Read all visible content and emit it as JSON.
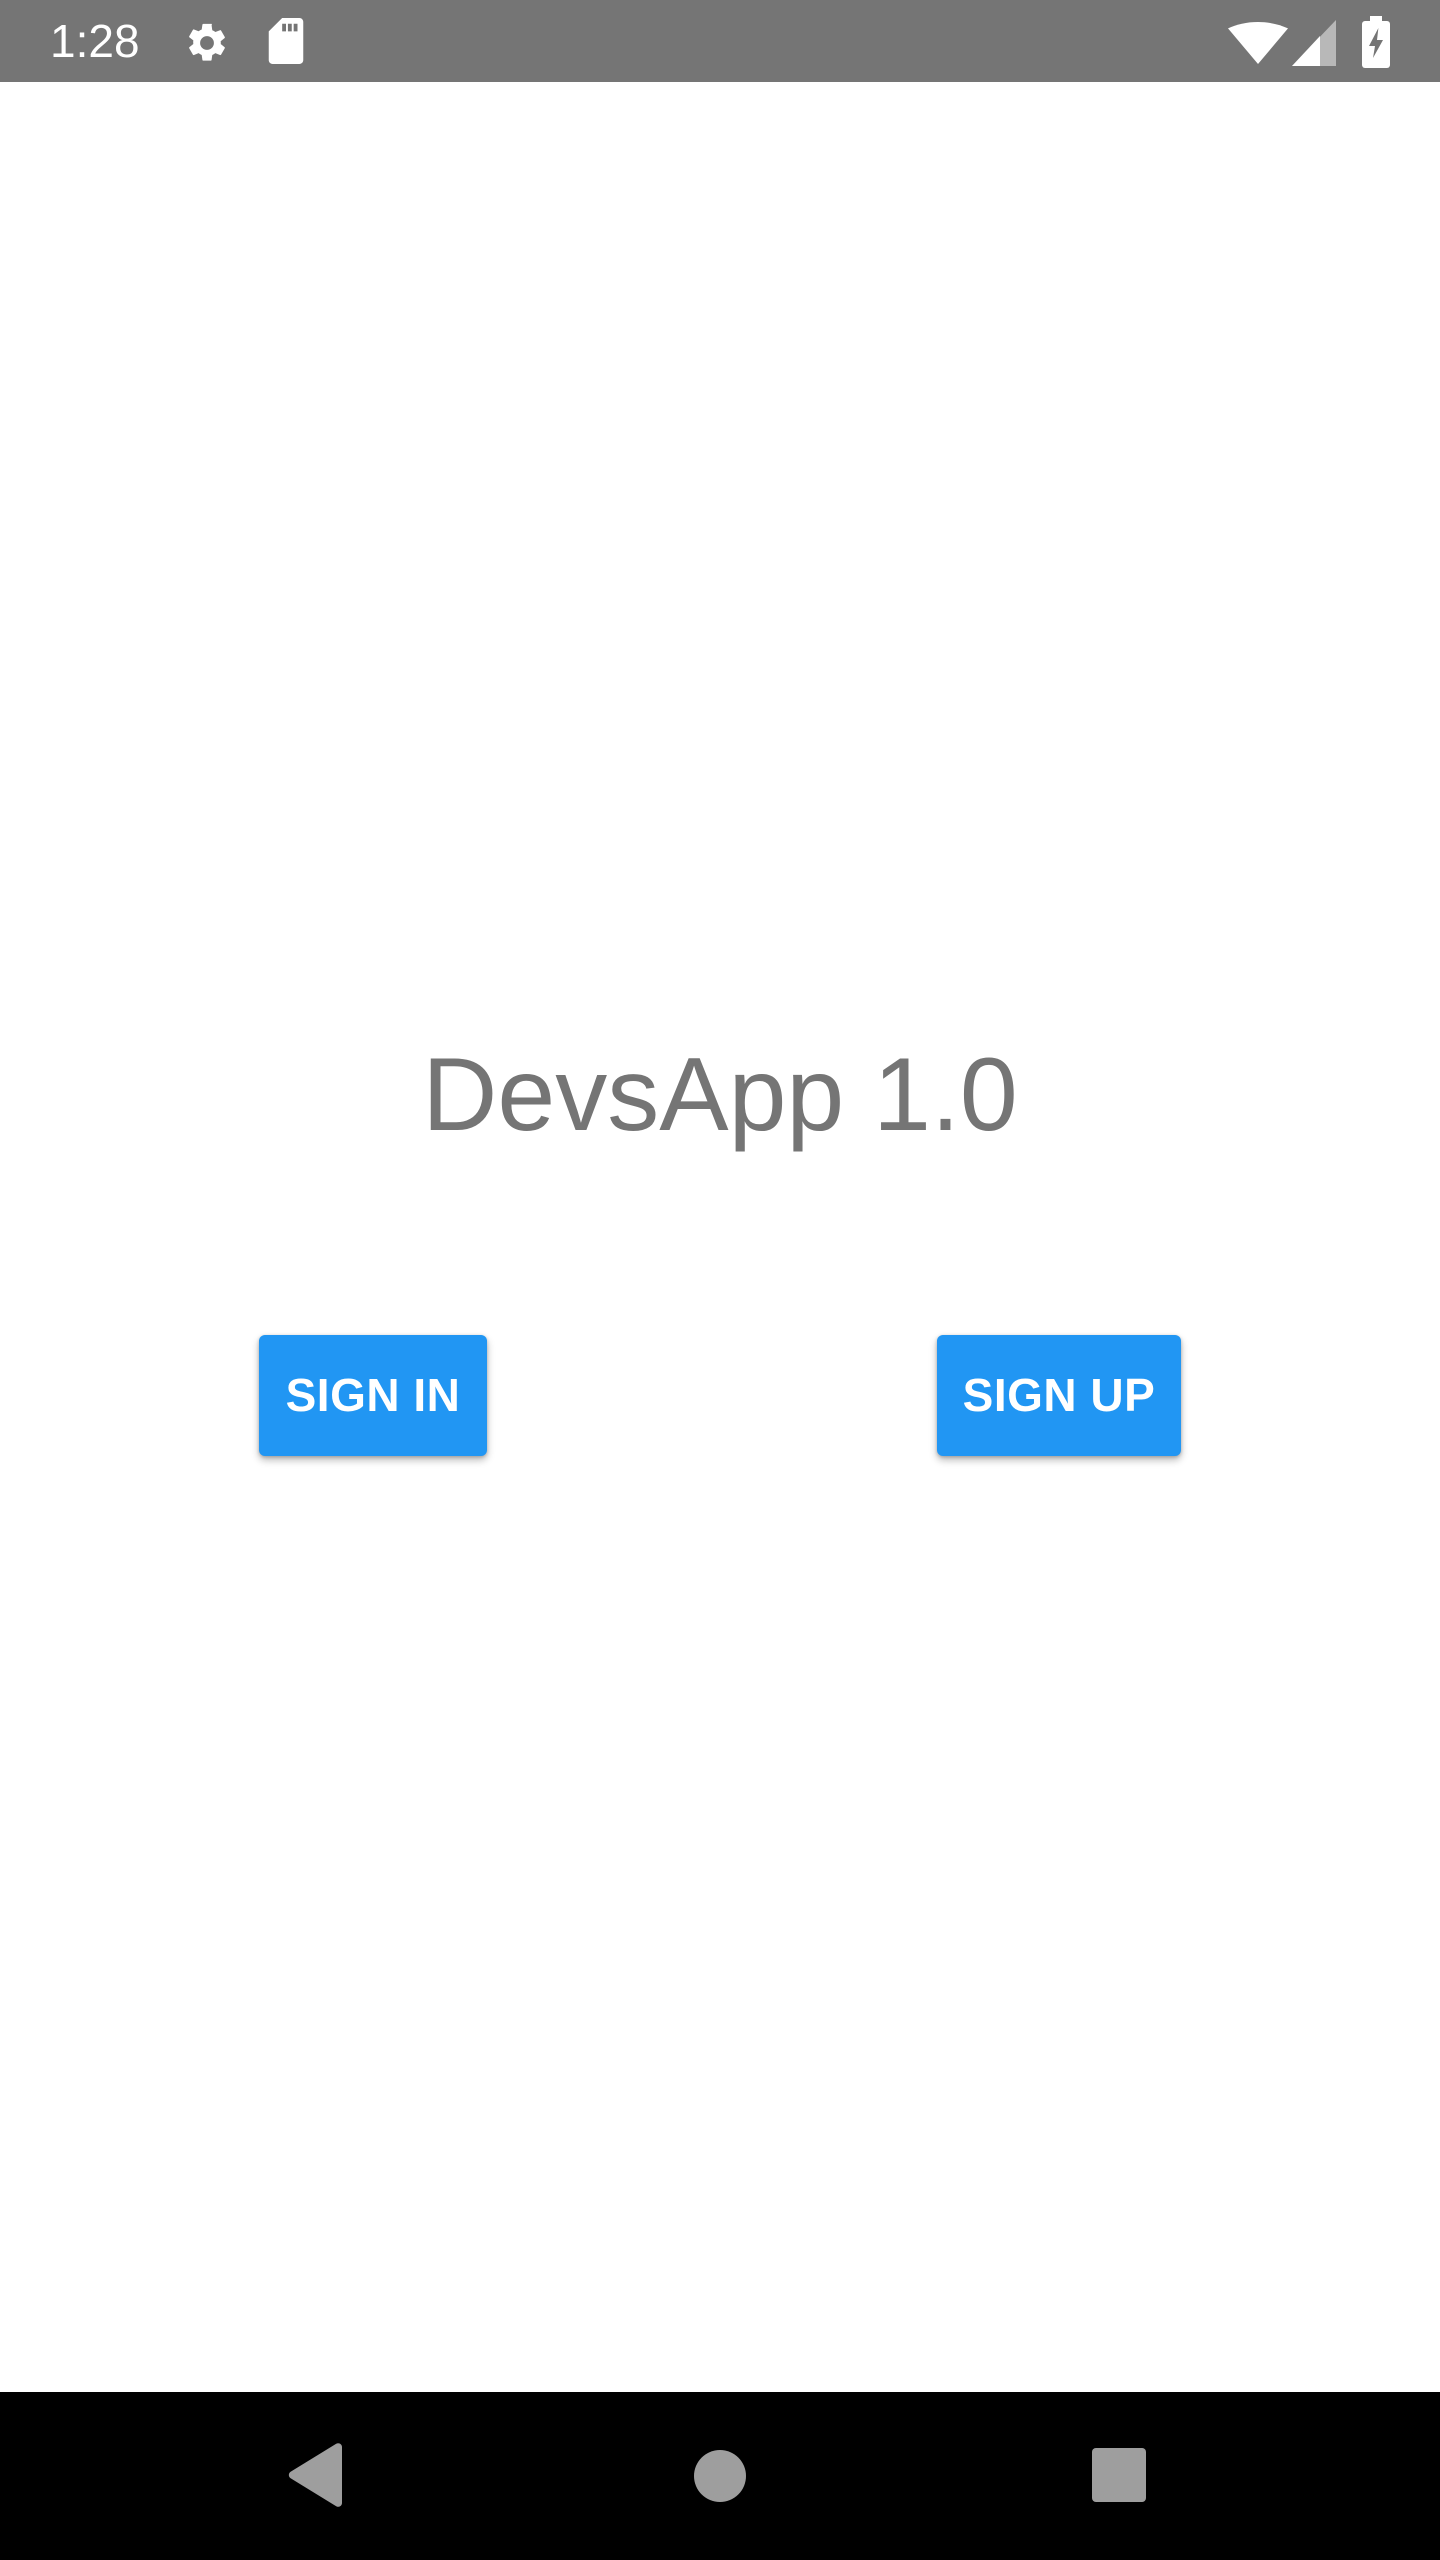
{
  "status_bar": {
    "time": "1:28",
    "icons": [
      "gear-icon",
      "sd-card-icon",
      "wifi-icon",
      "signal-icon",
      "battery-charging-icon"
    ],
    "background_color": "#757575"
  },
  "main": {
    "title": "DevsApp 1.0",
    "title_color": "#757575",
    "sign_in_label": "SIGN IN",
    "sign_up_label": "SIGN UP",
    "button_color": "#2196f3"
  },
  "nav_bar": {
    "icons": [
      "back-icon",
      "home-icon",
      "recents-icon"
    ]
  }
}
